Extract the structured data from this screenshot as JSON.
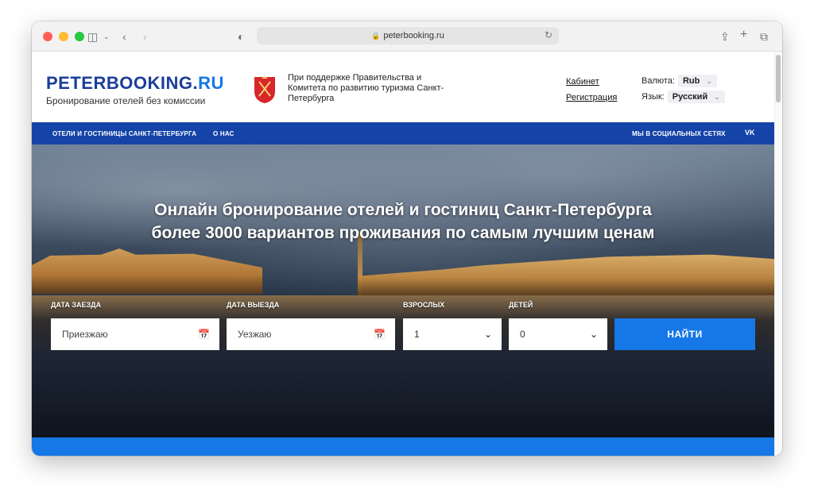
{
  "browser": {
    "url": "peterbooking.ru"
  },
  "site": {
    "logo_main": "PETERBOOKING.",
    "logo_accent": "RU",
    "tagline": "Бронирование отелей без комиссии",
    "support_text": "При поддержке Правительства и Комитета по развитию туризма Санкт-Петербурга",
    "links": {
      "cabinet": "Кабинет",
      "register": "Регистрация"
    },
    "currency_label": "Валюта:",
    "currency_value": "Rub",
    "language_label": "Язык:",
    "language_value": "Русский"
  },
  "nav": {
    "hotels": "ОТЕЛИ И ГОСТИНИЦЫ САНКТ-ПЕТЕРБУРГА",
    "about": "О НАС",
    "social": "МЫ В СОЦИАЛЬНЫХ СЕТЯХ",
    "vk": "VK"
  },
  "hero": {
    "title_line1": "Онлайн бронирование отелей и гостиниц Санкт-Петербурга",
    "title_line2": "более 3000 вариантов проживания по самым лучшим ценам"
  },
  "search": {
    "checkin_label": "ДАТА ЗАЕЗДА",
    "checkin_placeholder": "Приезжаю",
    "checkout_label": "ДАТА ВЫЕЗДА",
    "checkout_placeholder": "Уезжаю",
    "adults_label": "ВЗРОСЛЫХ",
    "adults_value": "1",
    "children_label": "ДЕТЕЙ",
    "children_value": "0",
    "button": "НАЙТИ"
  },
  "colors": {
    "brand_dark": "#1b3d99",
    "brand_accent": "#1677e6",
    "nav_bg": "#1544a8"
  }
}
